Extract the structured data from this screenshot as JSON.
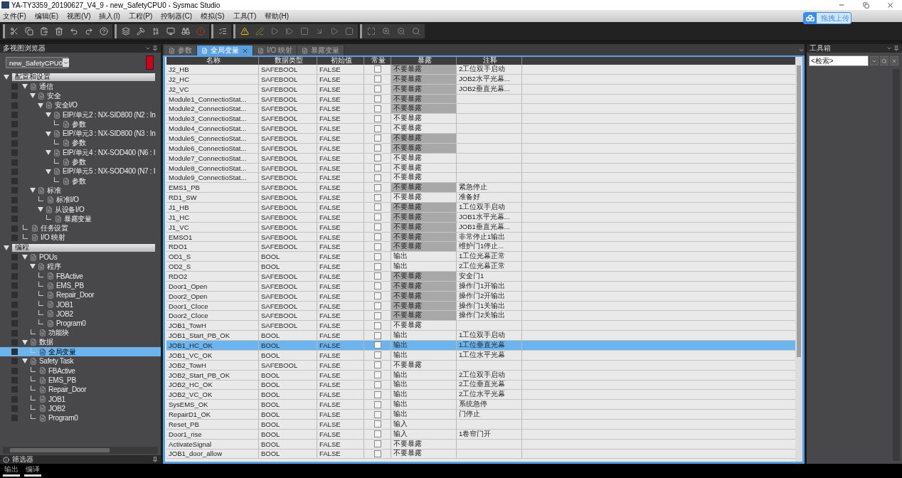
{
  "window": {
    "title": "YA-TY3359_20190627_V4_9 - new_SafetyCPU0 - Sysmac Studio"
  },
  "menu": [
    "文件(F)",
    "编辑(E)",
    "视图(V)",
    "插入(I)",
    "工程(P)",
    "控制器(C)",
    "模拟(S)",
    "工具(T)",
    "帮助(H)"
  ],
  "upload_button": {
    "label": "拖拽上传"
  },
  "explorer": {
    "title": "多视图浏览器",
    "device": "new_SafetyCPU0",
    "filter_label": "筛选器",
    "tree": [
      {
        "label": "配置和设置",
        "kind": "section",
        "expanded": true,
        "children": [
          {
            "label": "通信",
            "expanded": true,
            "selected": false,
            "children": [
              {
                "label": "安全",
                "expanded": true,
                "selected": false,
                "children": [
                  {
                    "label": "安全I/O",
                    "expanded": true,
                    "selected": false,
                    "children": [
                      {
                        "label": "EIP/单元2 : NX-SID800 (N2 : In",
                        "expanded": true,
                        "selected": false,
                        "children": [
                          {
                            "label": "参数",
                            "selected": false
                          }
                        ]
                      },
                      {
                        "label": "EIP/单元3 : NX-SID800 (N3 : In",
                        "expanded": true,
                        "selected": false,
                        "children": [
                          {
                            "label": "参数",
                            "selected": false
                          }
                        ]
                      },
                      {
                        "label": "EIP/单元4 : NX-SOD400 (N6 : I",
                        "expanded": true,
                        "selected": false,
                        "children": [
                          {
                            "label": "参数",
                            "selected": false
                          }
                        ]
                      },
                      {
                        "label": "EIP/单元5 : NX-SOD400 (N7 : I",
                        "expanded": true,
                        "selected": false,
                        "children": [
                          {
                            "label": "参数",
                            "selected": false
                          }
                        ]
                      }
                    ]
                  }
                ]
              },
              {
                "label": "标准",
                "expanded": true,
                "selected": false,
                "children": [
                  {
                    "label": "标准I/O",
                    "selected": false
                  },
                  {
                    "label": "从设备I/O",
                    "expanded": true,
                    "selected": false,
                    "children": [
                      {
                        "label": "暴露变量",
                        "selected": false
                      }
                    ]
                  }
                ]
              }
            ]
          },
          {
            "label": "任务设置",
            "selected": false
          },
          {
            "label": "I/O 映射",
            "selected": false
          }
        ]
      },
      {
        "label": "编程",
        "kind": "section",
        "expanded": true,
        "children": [
          {
            "label": "POUs",
            "expanded": true,
            "selected": false,
            "children": [
              {
                "label": "程序",
                "expanded": true,
                "selected": false,
                "children": [
                  {
                    "label": "FBActive",
                    "selected": false
                  },
                  {
                    "label": "EMS_PB",
                    "selected": false
                  },
                  {
                    "label": "Repair_Door",
                    "selected": false
                  },
                  {
                    "label": "JOB1",
                    "selected": false
                  },
                  {
                    "label": "JOB2",
                    "selected": false
                  },
                  {
                    "label": "Program0",
                    "selected": false
                  }
                ]
              },
              {
                "label": "功能块",
                "selected": false
              }
            ]
          },
          {
            "label": "数据",
            "expanded": true,
            "selected": false,
            "children": [
              {
                "label": "全局变量",
                "selected": true
              }
            ]
          },
          {
            "label": "Safety Task",
            "expanded": true,
            "selected": false,
            "children": [
              {
                "label": "FBActive",
                "selected": false
              },
              {
                "label": "EMS_PB",
                "selected": false
              },
              {
                "label": "Repair_Door",
                "selected": false
              },
              {
                "label": "JOB1",
                "selected": false
              },
              {
                "label": "JOB2",
                "selected": false
              },
              {
                "label": "Program0",
                "selected": false
              }
            ]
          }
        ]
      }
    ]
  },
  "editor_tabs": [
    {
      "label": "参数",
      "selected": false,
      "closable": false
    },
    {
      "label": "全局变量",
      "selected": true,
      "closable": true
    },
    {
      "label": "I/O 映射",
      "selected": false,
      "closable": false
    },
    {
      "label": "暴露变量",
      "selected": false,
      "closable": false
    }
  ],
  "table": {
    "columns": [
      "名称",
      "数据类型",
      "初始值",
      "常量",
      "暴露",
      "注释"
    ],
    "rows": [
      {
        "name": "J2_HB",
        "type": "SAFEBOOL",
        "initial": "FALSE",
        "constant": false,
        "exposure": "不要暴露",
        "shaded": true,
        "comment": "2工位双手启动",
        "selected": false
      },
      {
        "name": "J2_HC",
        "type": "SAFEBOOL",
        "initial": "FALSE",
        "constant": false,
        "exposure": "不要暴露",
        "shaded": true,
        "comment": "JOB2水平光幕...",
        "selected": false
      },
      {
        "name": "J2_VC",
        "type": "SAFEBOOL",
        "initial": "FALSE",
        "constant": false,
        "exposure": "不要暴露",
        "shaded": true,
        "comment": "JOB2垂直光幕...",
        "selected": false
      },
      {
        "name": "Module1_ConnectioStat...",
        "type": "SAFEBOOL",
        "initial": "FALSE",
        "constant": false,
        "exposure": "不要暴露",
        "shaded": true,
        "selected": false
      },
      {
        "name": "Module2_ConnectioStat...",
        "type": "SAFEBOOL",
        "initial": "FALSE",
        "constant": false,
        "exposure": "不要暴露",
        "shaded": true,
        "selected": false
      },
      {
        "name": "Module3_ConnectioStat...",
        "type": "SAFEBOOL",
        "initial": "FALSE",
        "constant": false,
        "exposure": "不要暴露",
        "shaded": false,
        "selected": false
      },
      {
        "name": "Module4_ConnectioStat...",
        "type": "SAFEBOOL",
        "initial": "FALSE",
        "constant": false,
        "exposure": "不要暴露",
        "shaded": false,
        "selected": false
      },
      {
        "name": "Module5_ConnectioStat...",
        "type": "SAFEBOOL",
        "initial": "FALSE",
        "constant": false,
        "exposure": "不要暴露",
        "shaded": true,
        "selected": false
      },
      {
        "name": "Module6_ConnectioStat...",
        "type": "SAFEBOOL",
        "initial": "FALSE",
        "constant": false,
        "exposure": "不要暴露",
        "shaded": true,
        "selected": false
      },
      {
        "name": "Module7_ConnectioStat...",
        "type": "SAFEBOOL",
        "initial": "FALSE",
        "constant": false,
        "exposure": "不要暴露",
        "shaded": false,
        "selected": false
      },
      {
        "name": "Module8_ConnectioStat...",
        "type": "SAFEBOOL",
        "initial": "FALSE",
        "constant": false,
        "exposure": "不要暴露",
        "shaded": false,
        "selected": false
      },
      {
        "name": "Module9_ConnectioStat...",
        "type": "SAFEBOOL",
        "initial": "FALSE",
        "constant": false,
        "exposure": "不要暴露",
        "shaded": false,
        "selected": false
      },
      {
        "name": "EMS1_PB",
        "type": "SAFEBOOL",
        "initial": "FALSE",
        "constant": false,
        "exposure": "不要暴露",
        "shaded": true,
        "comment": "紧急停止",
        "selected": false
      },
      {
        "name": "RD1_SW",
        "type": "SAFEBOOL",
        "initial": "FALSE",
        "constant": false,
        "exposure": "不要暴露",
        "shaded": false,
        "comment": "准备好",
        "selected": false
      },
      {
        "name": "J1_HB",
        "type": "SAFEBOOL",
        "initial": "FALSE",
        "constant": false,
        "exposure": "不要暴露",
        "shaded": true,
        "comment": "1工位双手启动",
        "selected": false
      },
      {
        "name": "J1_HC",
        "type": "SAFEBOOL",
        "initial": "FALSE",
        "constant": false,
        "exposure": "不要暴露",
        "shaded": true,
        "comment": "JOB1水平光幕...",
        "selected": false
      },
      {
        "name": "J1_VC",
        "type": "SAFEBOOL",
        "initial": "FALSE",
        "constant": false,
        "exposure": "不要暴露",
        "shaded": true,
        "comment": "JOB1垂直光幕...",
        "selected": false
      },
      {
        "name": "EMSO1",
        "type": "SAFEBOOL",
        "initial": "FALSE",
        "constant": false,
        "exposure": "不要暴露",
        "shaded": true,
        "comment": "非常停止1输出",
        "selected": false
      },
      {
        "name": "RDO1",
        "type": "SAFEBOOL",
        "initial": "FALSE",
        "constant": false,
        "exposure": "不要暴露",
        "shaded": true,
        "comment": "维护门1停止...",
        "selected": false
      },
      {
        "name": "OD1_S",
        "type": "BOOL",
        "initial": "FALSE",
        "constant": false,
        "exposure": "输出",
        "shaded": false,
        "comment": "1工位光幕正常",
        "selected": false
      },
      {
        "name": "OD2_S",
        "type": "BOOL",
        "initial": "FALSE",
        "constant": false,
        "exposure": "输出",
        "shaded": false,
        "comment": "2工位光幕正常",
        "selected": false
      },
      {
        "name": "RDO2",
        "type": "SAFEBOOL",
        "initial": "FALSE",
        "constant": false,
        "exposure": "不要暴露",
        "shaded": true,
        "comment": "安全门1",
        "selected": false
      },
      {
        "name": "Door1_Open",
        "type": "SAFEBOOL",
        "initial": "FALSE",
        "constant": false,
        "exposure": "不要暴露",
        "shaded": true,
        "comment": "操作门1开输出",
        "selected": false
      },
      {
        "name": "Door2_Open",
        "type": "SAFEBOOL",
        "initial": "FALSE",
        "constant": false,
        "exposure": "不要暴露",
        "shaded": true,
        "comment": "操作门2开输出",
        "selected": false
      },
      {
        "name": "Door1_Cloce",
        "type": "SAFEBOOL",
        "initial": "FALSE",
        "constant": false,
        "exposure": "不要暴露",
        "shaded": true,
        "comment": "操作门1关输出",
        "selected": false
      },
      {
        "name": "Door2_Cloce",
        "type": "SAFEBOOL",
        "initial": "FALSE",
        "constant": false,
        "exposure": "不要暴露",
        "shaded": true,
        "comment": "操作门2关输出",
        "selected": false
      },
      {
        "name": "JOB1_TowH",
        "type": "SAFEBOOL",
        "initial": "FALSE",
        "constant": false,
        "exposure": "不要暴露",
        "shaded": false,
        "selected": false
      },
      {
        "name": "JOB1_Start_PB_OK",
        "type": "BOOL",
        "initial": "FALSE",
        "constant": false,
        "exposure": "输出",
        "shaded": false,
        "comment": "1工位双手启动",
        "selected": false
      },
      {
        "name": "JOB1_HC_OK",
        "type": "BOOL",
        "initial": "FALSE",
        "constant": false,
        "exposure": "输出",
        "shaded": false,
        "comment": "1工位垂直光幕",
        "selected": true
      },
      {
        "name": "JOB1_VC_OK",
        "type": "BOOL",
        "initial": "FALSE",
        "constant": false,
        "exposure": "输出",
        "shaded": false,
        "comment": "1工位水平光幕",
        "selected": false
      },
      {
        "name": "JOB2_TowH",
        "type": "SAFEBOOL",
        "initial": "FALSE",
        "constant": false,
        "exposure": "不要暴露",
        "shaded": false,
        "selected": false
      },
      {
        "name": "JOB2_Start_PB_OK",
        "type": "BOOL",
        "initial": "FALSE",
        "constant": false,
        "exposure": "输出",
        "shaded": false,
        "comment": "2工位双手启动",
        "selected": false
      },
      {
        "name": "JOB2_HC_OK",
        "type": "BOOL",
        "initial": "FALSE",
        "constant": false,
        "exposure": "输出",
        "shaded": false,
        "comment": "2工位垂直光幕",
        "selected": false
      },
      {
        "name": "JOB2_VC_OK",
        "type": "BOOL",
        "initial": "FALSE",
        "constant": false,
        "exposure": "输出",
        "shaded": false,
        "comment": "2工位水平光幕",
        "selected": false
      },
      {
        "name": "SysEMS_OK",
        "type": "BOOL",
        "initial": "FALSE",
        "constant": false,
        "exposure": "输出",
        "shaded": false,
        "comment": "系统急停",
        "selected": false
      },
      {
        "name": "RepairD1_OK",
        "type": "BOOL",
        "initial": "FALSE",
        "constant": false,
        "exposure": "输出",
        "shaded": false,
        "comment": "门停止",
        "selected": false
      },
      {
        "name": "Reset_PB",
        "type": "BOOL",
        "initial": "FALSE",
        "constant": false,
        "exposure": "输入",
        "shaded": false,
        "selected": false
      },
      {
        "name": "Door1_rise",
        "type": "BOOL",
        "initial": "FALSE",
        "constant": false,
        "exposure": "输入",
        "shaded": false,
        "comment": "1卷帘门开",
        "selected": false
      },
      {
        "name": "ActivateSignal",
        "type": "BOOL",
        "initial": "FALSE",
        "constant": false,
        "exposure": "不要暴露",
        "shaded": false,
        "selected": false
      },
      {
        "name": "JOB1_door_allow",
        "type": "BOOL",
        "initial": "FALSE",
        "constant": false,
        "exposure": "不要暴露",
        "shaded": false,
        "selected": false
      }
    ]
  },
  "toolbox": {
    "title": "工具箱",
    "search_placeholder": "<检索>"
  },
  "bottom_tabs": [
    {
      "label": "输出",
      "selected": false
    },
    {
      "label": "编译",
      "selected": false
    }
  ]
}
